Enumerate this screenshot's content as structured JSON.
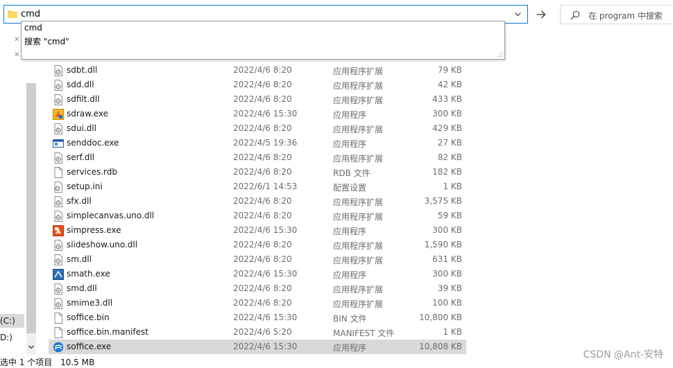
{
  "address_bar": {
    "value": "cmd",
    "dropdown_icon": "chevron-down-icon",
    "folder_icon": "folder-icon"
  },
  "go_button": {
    "icon": "arrow-right-icon"
  },
  "search": {
    "placeholder": "在 program 中搜索",
    "icon": "search-icon"
  },
  "suggestions": [
    {
      "label": "cmd"
    },
    {
      "label": "搜索 \"cmd\""
    }
  ],
  "nav": {
    "drives": [
      {
        "label": "(C:)",
        "selected": true
      },
      {
        "label": "D:)",
        "selected": false
      }
    ],
    "pin_glyph": "✕"
  },
  "status": {
    "selected": "选中 1 个项目",
    "size": "10.5 MB"
  },
  "files": [
    {
      "name": "sdbt.dll",
      "date": "2022/4/6 8:20",
      "type": "应用程序扩展",
      "size": "79 KB",
      "icon": "dll-icon"
    },
    {
      "name": "sdd.dll",
      "date": "2022/4/6 8:20",
      "type": "应用程序扩展",
      "size": "42 KB",
      "icon": "dll-icon"
    },
    {
      "name": "sdfilt.dll",
      "date": "2022/4/6 8:20",
      "type": "应用程序扩展",
      "size": "433 KB",
      "icon": "dll-icon"
    },
    {
      "name": "sdraw.exe",
      "date": "2022/4/6 15:30",
      "type": "应用程序",
      "size": "300 KB",
      "icon": "draw-exe-icon"
    },
    {
      "name": "sdui.dll",
      "date": "2022/4/6 8:20",
      "type": "应用程序扩展",
      "size": "429 KB",
      "icon": "dll-icon"
    },
    {
      "name": "senddoc.exe",
      "date": "2022/4/5 19:36",
      "type": "应用程序",
      "size": "27 KB",
      "icon": "window-exe-icon"
    },
    {
      "name": "serf.dll",
      "date": "2022/4/6 8:20",
      "type": "应用程序扩展",
      "size": "82 KB",
      "icon": "dll-icon"
    },
    {
      "name": "services.rdb",
      "date": "2022/4/6 8:20",
      "type": "RDB 文件",
      "size": "182 KB",
      "icon": "blank-file-icon"
    },
    {
      "name": "setup.ini",
      "date": "2022/6/1 14:53",
      "type": "配置设置",
      "size": "1 KB",
      "icon": "ini-file-icon"
    },
    {
      "name": "sfx.dll",
      "date": "2022/4/6 8:20",
      "type": "应用程序扩展",
      "size": "3,575 KB",
      "icon": "dll-icon"
    },
    {
      "name": "simplecanvas.uno.dll",
      "date": "2022/4/6 8:20",
      "type": "应用程序扩展",
      "size": "59 KB",
      "icon": "dll-icon"
    },
    {
      "name": "simpress.exe",
      "date": "2022/4/6 15:30",
      "type": "应用程序",
      "size": "300 KB",
      "icon": "impress-exe-icon"
    },
    {
      "name": "slideshow.uno.dll",
      "date": "2022/4/6 8:20",
      "type": "应用程序扩展",
      "size": "1,590 KB",
      "icon": "dll-icon"
    },
    {
      "name": "sm.dll",
      "date": "2022/4/6 8:20",
      "type": "应用程序扩展",
      "size": "631 KB",
      "icon": "dll-icon"
    },
    {
      "name": "smath.exe",
      "date": "2022/4/6 15:30",
      "type": "应用程序",
      "size": "300 KB",
      "icon": "math-exe-icon"
    },
    {
      "name": "smd.dll",
      "date": "2022/4/6 8:20",
      "type": "应用程序扩展",
      "size": "39 KB",
      "icon": "dll-icon"
    },
    {
      "name": "smime3.dll",
      "date": "2022/4/6 8:20",
      "type": "应用程序扩展",
      "size": "100 KB",
      "icon": "dll-icon"
    },
    {
      "name": "soffice.bin",
      "date": "2022/4/6 15:30",
      "type": "BIN 文件",
      "size": "10,800 KB",
      "icon": "blank-file-icon"
    },
    {
      "name": "soffice.bin.manifest",
      "date": "2022/4/6 5:20",
      "type": "MANIFEST 文件",
      "size": "1 KB",
      "icon": "blank-file-icon"
    },
    {
      "name": "soffice.exe",
      "date": "2022/4/6 15:30",
      "type": "应用程序",
      "size": "10,808 KB",
      "icon": "soffice-exe-icon",
      "selected": true
    }
  ],
  "watermark": "CSDN @Ant-安特",
  "colors": {
    "accent": "#0078d7",
    "selection": "#d9d9d9",
    "muted_text": "#6d6d6d"
  }
}
